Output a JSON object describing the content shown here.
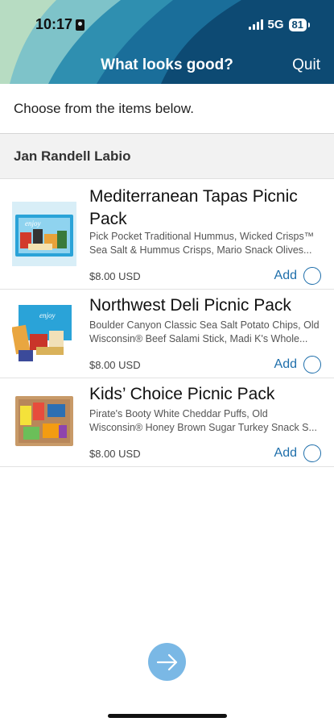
{
  "status_bar": {
    "time": "10:17",
    "network": "5G",
    "battery": "81"
  },
  "nav": {
    "title": "What looks good?",
    "quit_label": "Quit"
  },
  "instructions": "Choose from the items below.",
  "section": {
    "name": "Jan Randell Labio"
  },
  "items": [
    {
      "title": "Mediterranean Tapas Picnic Pack",
      "description": "Pick Pocket Traditional Hummus, Wicked Crisps™ Sea Salt & Hummus Crisps, Mario Snack Olives...",
      "price": "$8.00 USD",
      "add_label": "Add",
      "box_text": "enjoy"
    },
    {
      "title": "Northwest Deli Picnic Pack",
      "description": "Boulder Canyon Classic Sea Salt Potato Chips, Old Wisconsin® Beef Salami Stick, Madi K's Whole...",
      "price": "$8.00 USD",
      "add_label": "Add",
      "box_text": "enjoy"
    },
    {
      "title": "Kids’ Choice Picnic Pack",
      "description": "Pirate's Booty White Cheddar Puffs, Old Wisconsin® Honey Brown Sugar Turkey Snack S...",
      "price": "$8.00 USD",
      "add_label": "Add"
    }
  ],
  "colors": {
    "header": "#0d4a73",
    "accent": "#1f6fab",
    "next_button": "#7ab8e5"
  },
  "icons": {
    "next": "arrow-right-icon",
    "radio": "radio-unchecked-icon"
  }
}
